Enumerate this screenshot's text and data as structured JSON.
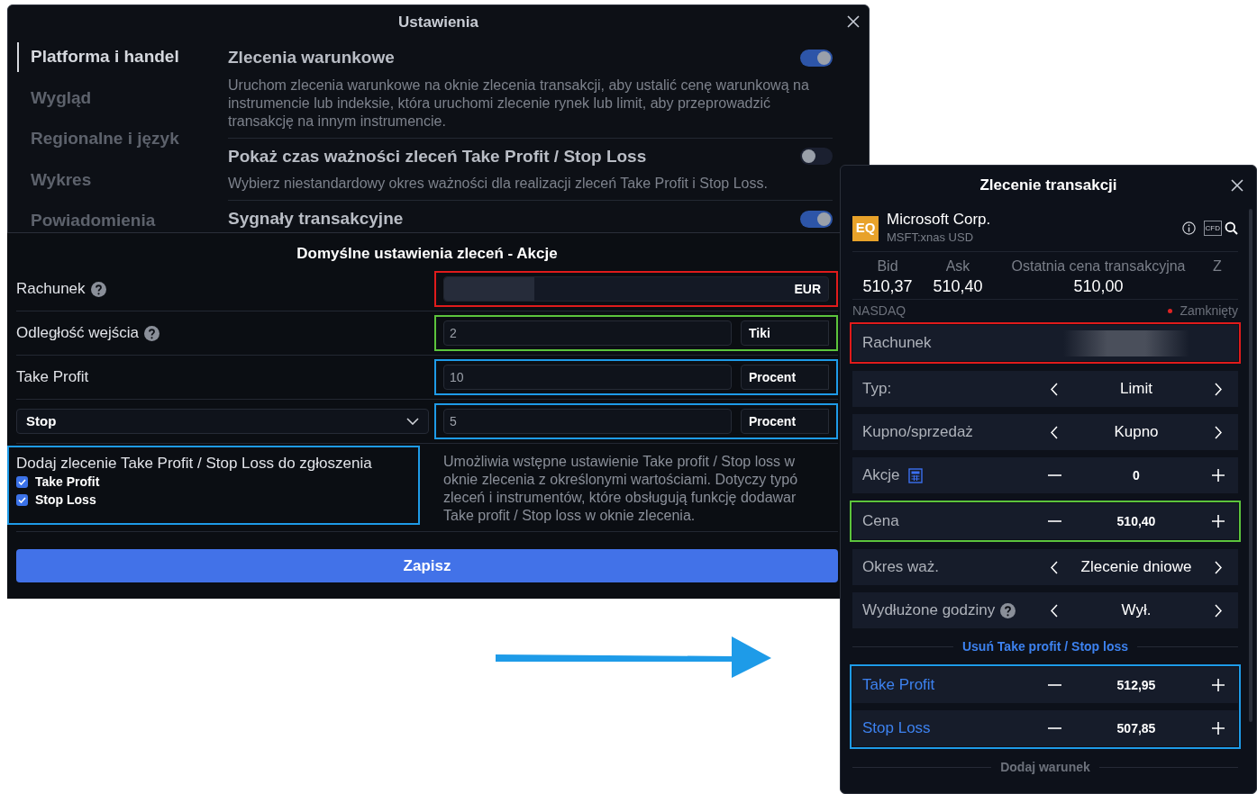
{
  "settings_window": {
    "title": "Ustawienia",
    "sidebar": [
      {
        "label": "Platforma i handel",
        "selected": true
      },
      {
        "label": "Wygląd",
        "selected": false
      },
      {
        "label": "Regionalne i język",
        "selected": false
      },
      {
        "label": "Wykres",
        "selected": false
      },
      {
        "label": "Powiadomienia",
        "selected": false
      }
    ],
    "settings": [
      {
        "title": "Zlecenia warunkowe",
        "description": "Uruchom zlecenia warunkowe na oknie zlecenia transakcji, aby ustalić cenę warunkową na instrumencie lub indeksie, która uruchomi zlecenie rynek lub limit, aby przeprowadzić transakcję na innym instrumencie.",
        "on": true
      },
      {
        "title": "Pokaż czas ważności zleceń Take Profit / Stop Loss",
        "description": "Wybierz niestandardowy okres ważności dla realizacji zleceń Take Profit i Stop Loss.",
        "on": false
      },
      {
        "title": "Sygnały transakcyjne",
        "on": true
      }
    ]
  },
  "order_defaults": {
    "title": "Domyślne ustawienia zleceń - Akcje",
    "rows": [
      {
        "kind": "account",
        "label": "Rachunek",
        "help": true,
        "value": "EUR",
        "color": "#e01b1b"
      },
      {
        "kind": "number",
        "label": "Odległość wejścia",
        "help": true,
        "value": "2",
        "unit": "Tiki",
        "color": "#5cc43c"
      },
      {
        "kind": "number",
        "label": "Take Profit",
        "value": "10",
        "unit": "Procent",
        "color": "#1e9be8"
      },
      {
        "kind": "select",
        "label": "Stop",
        "value": "5",
        "unit": "Procent",
        "color": "#1e9be8"
      }
    ],
    "attach": {
      "title": "Dodaj zlecenie Take Profit / Stop Loss do zgłoszenia",
      "color": "#1e9be8",
      "options": [
        {
          "label": "Take Profit",
          "checked": true
        },
        {
          "label": "Stop Loss",
          "checked": true
        }
      ]
    },
    "description_lines": [
      "Umożliwia wstępne ustawienie Take profit / Stop loss w",
      "oknie zlecenia z określonymi wartościami. Dotyczy typó",
      "zleceń i instrumentów, które obsługują funkcję dodawar",
      "Take profit / Stop loss w oknie zlecenia."
    ],
    "save": "Zapisz"
  },
  "order_ticket": {
    "title": "Zlecenie transakcji",
    "instrument": {
      "badge": "EQ",
      "name": "Microsoft Corp.",
      "symbol": "MSFT:xnas USD",
      "tag": "CFD"
    },
    "quotes": [
      {
        "label": "Bid",
        "value": "510,37"
      },
      {
        "label": "Ask",
        "value": "510,40"
      },
      {
        "label": "Ostatnia cena transakcyjna",
        "value": "510,00"
      },
      {
        "label": "Z"
      }
    ],
    "exchange": "NASDAQ",
    "market_status": "Zamknięty",
    "rows": [
      {
        "kind": "account",
        "label": "Rachunek",
        "color": "#e01b1b"
      },
      {
        "kind": "choice",
        "label": "Typ:",
        "value": "Limit"
      },
      {
        "kind": "choice",
        "label": "Kupno/sprzedaż",
        "value": "Kupno"
      },
      {
        "kind": "stepper",
        "label": "Akcje",
        "value": "0",
        "calculator": true
      },
      {
        "kind": "stepper",
        "label": "Cena",
        "value": "510,40",
        "color": "#5cc43c"
      },
      {
        "kind": "choice",
        "label": "Okres waż.",
        "value": "Zlecenie dniowe"
      },
      {
        "kind": "choice",
        "label": "Wydłużone godziny",
        "value": "Wył.",
        "help": true
      }
    ],
    "remove_link": "Usuń Take profit / Stop loss",
    "tp_sl": {
      "color": "#1e9be8",
      "rows": [
        {
          "kind": "stepper",
          "label": "Take Profit",
          "value": "512,95"
        },
        {
          "kind": "stepper",
          "label": "Stop Loss",
          "value": "507,85"
        }
      ]
    },
    "add_condition": "Dodaj warunek"
  }
}
